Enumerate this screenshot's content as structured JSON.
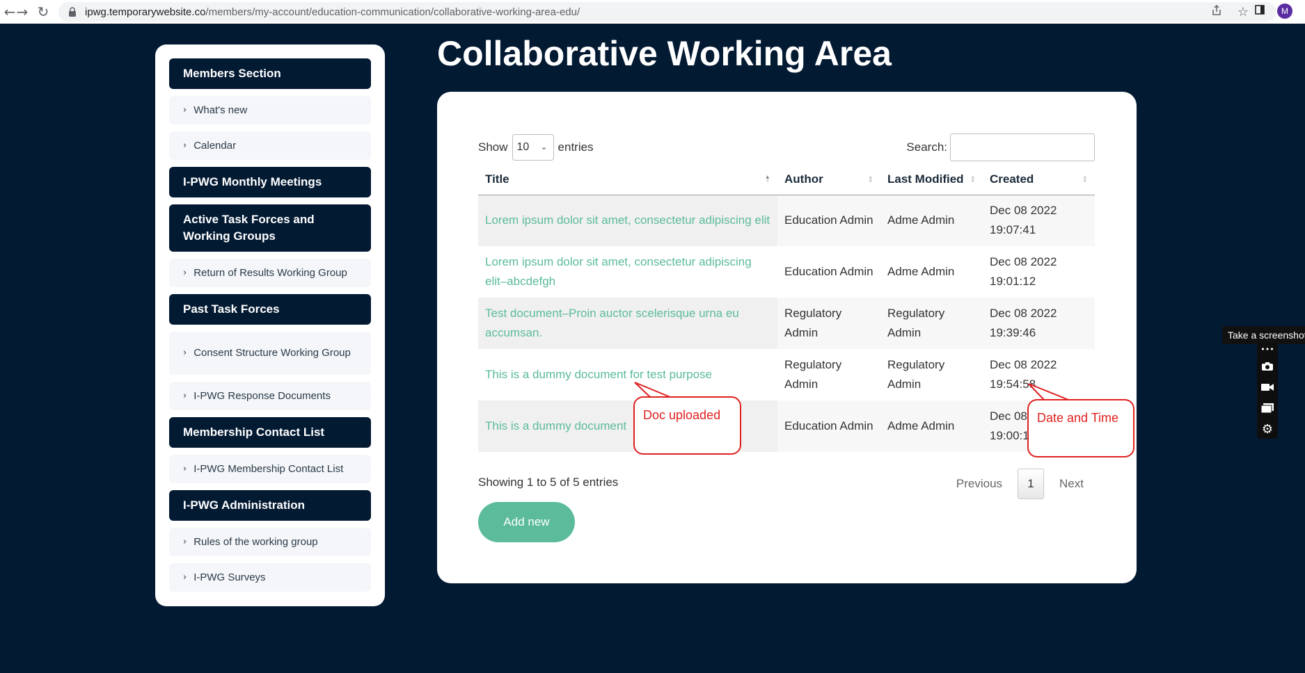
{
  "browser": {
    "url_domain": "ipwg.temporarywebsite.co",
    "url_path": "/members/my-account/education-communication/collaborative-working-area-edu/",
    "profile_initial": "M"
  },
  "sidebar": {
    "sections": [
      {
        "title": "Members Section",
        "items": [
          "What's new",
          "Calendar"
        ]
      },
      {
        "title": "I-PWG Monthly Meetings",
        "items": []
      },
      {
        "title": "Active Task Forces and Working Groups",
        "items": [
          "Return of Results Working Group"
        ]
      },
      {
        "title": "Past Task Forces",
        "items": [
          "Consent Structure Working Group",
          "I-PWG Response Documents"
        ]
      },
      {
        "title": "Membership Contact List",
        "items": [
          "I-PWG Membership Contact List"
        ]
      },
      {
        "title": "I-PWG Administration",
        "items": [
          "Rules of the working group",
          "I-PWG Surveys"
        ]
      }
    ]
  },
  "main": {
    "title": "Collaborative Working Area",
    "show_label": "Show",
    "entries_value": "10",
    "entries_label": "entries",
    "search_label": "Search:",
    "columns": [
      "Title",
      "Author",
      "Last Modified",
      "Created"
    ],
    "rows": [
      {
        "title": "Lorem ipsum dolor sit amet, consectetur adipiscing elit",
        "author": "Education Admin",
        "modified": "Adme Admin",
        "created": "Dec 08 2022 19:07:41"
      },
      {
        "title": "Lorem ipsum dolor sit amet, consectetur adipiscing elit–abcdefgh",
        "author": "Education Admin",
        "modified": "Adme Admin",
        "created": "Dec 08 2022 19:01:12"
      },
      {
        "title": "Test document–Proin auctor scelerisque urna eu accumsan.",
        "author": "Regulatory Admin",
        "modified": "Regulatory Admin",
        "created": "Dec 08 2022 19:39:46"
      },
      {
        "title": "This is a dummy document for test purpose",
        "author": "Regulatory Admin",
        "modified": "Regulatory Admin",
        "created": "Dec 08 2022 19:54:58"
      },
      {
        "title": "This is a dummy document",
        "author": "Education Admin",
        "modified": "Adme Admin",
        "created": "Dec 08 2022 19:00:11"
      }
    ],
    "info": "Showing 1 to 5 of 5 entries",
    "prev_label": "Previous",
    "page_number": "1",
    "next_label": "Next",
    "add_label": "Add new"
  },
  "annotations": {
    "doc_uploaded": "Doc uploaded",
    "date_and_time": "Date and Time",
    "color": "#e02020"
  },
  "screenshot_tool": {
    "tooltip": "Take a screenshot"
  },
  "colors": {
    "background": "#031a33",
    "accent": "#5bbb9a"
  }
}
